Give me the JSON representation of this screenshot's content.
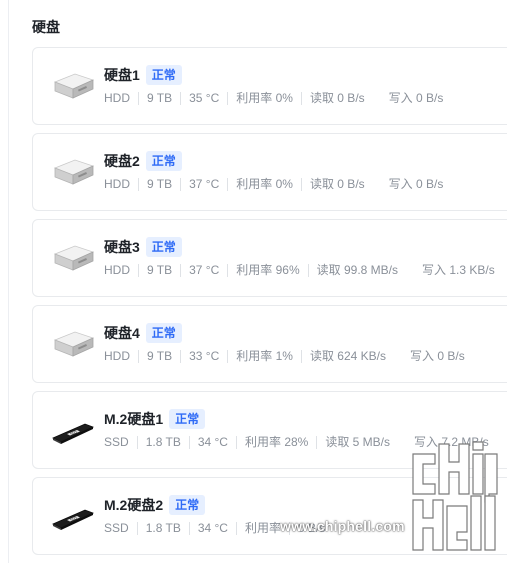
{
  "section": {
    "title": "硬盘"
  },
  "disks": [
    {
      "name": "硬盘1",
      "status": "正常",
      "icon": "hdd-icon",
      "type": "HDD",
      "capacity": "9 TB",
      "temperature": "35 °C",
      "utilization": "利用率 0%",
      "read": "读取 0 B/s",
      "write": "写入 0 B/s"
    },
    {
      "name": "硬盘2",
      "status": "正常",
      "icon": "hdd-icon",
      "type": "HDD",
      "capacity": "9 TB",
      "temperature": "37 °C",
      "utilization": "利用率 0%",
      "read": "读取 0 B/s",
      "write": "写入 0 B/s"
    },
    {
      "name": "硬盘3",
      "status": "正常",
      "icon": "hdd-icon",
      "type": "HDD",
      "capacity": "9 TB",
      "temperature": "37 °C",
      "utilization": "利用率 96%",
      "read": "读取 99.8 MB/s",
      "write": "写入 1.3 KB/s"
    },
    {
      "name": "硬盘4",
      "status": "正常",
      "icon": "hdd-icon",
      "type": "HDD",
      "capacity": "9 TB",
      "temperature": "33 °C",
      "utilization": "利用率 1%",
      "read": "读取 624 KB/s",
      "write": "写入 0 B/s"
    },
    {
      "name": "M.2硬盘1",
      "status": "正常",
      "icon": "ssd-icon",
      "type": "SSD",
      "capacity": "1.8 TB",
      "temperature": "34 °C",
      "utilization": "利用率 28%",
      "read": "读取 5 MB/s",
      "write": "写入 7.2 MB/s"
    },
    {
      "name": "M.2硬盘2",
      "status": "正常",
      "icon": "ssd-icon",
      "type": "SSD",
      "capacity": "1.8 TB",
      "temperature": "34 °C",
      "utilization": "利用率",
      "read": "0 B/s",
      "write": ""
    }
  ],
  "watermark": {
    "text": "www.chiphell.com",
    "logo": "chiphell-logo"
  },
  "colors": {
    "badge_text": "#2f6bf6",
    "badge_bg": "#e6efff",
    "meta_text": "#8a9099",
    "card_border": "#e8eaed"
  }
}
